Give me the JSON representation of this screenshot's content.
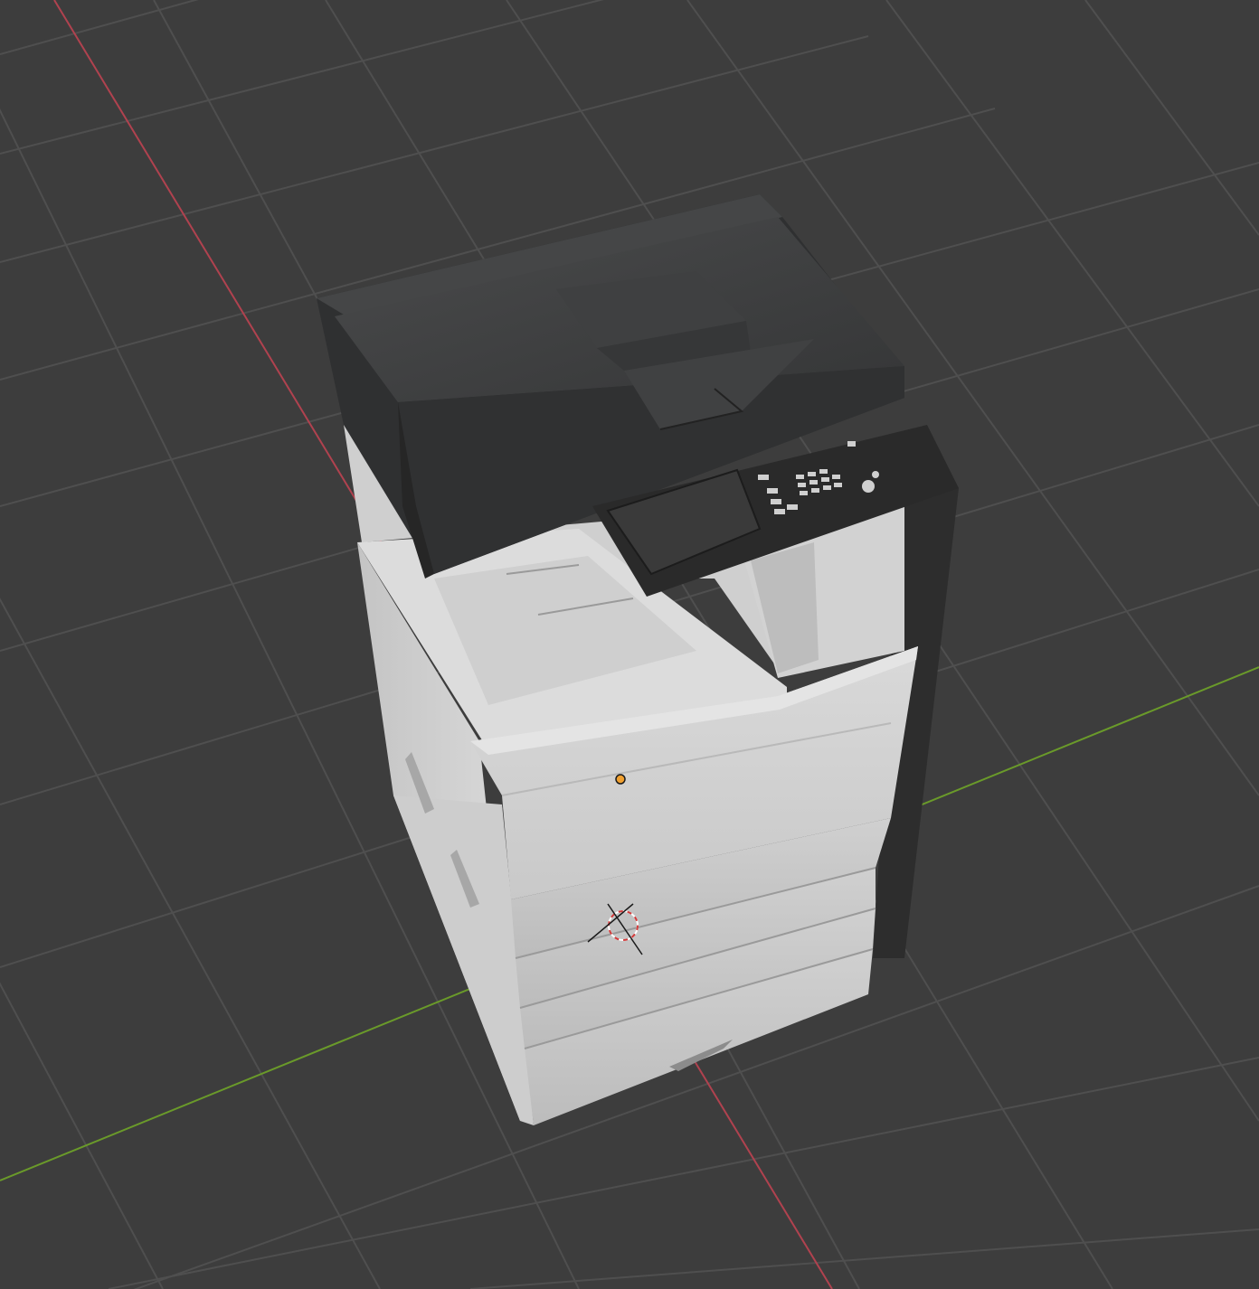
{
  "viewport": {
    "background": "#3d3d3d",
    "grid_color": "#505050",
    "x_axis_color": "#b0424f",
    "y_axis_color": "#6a9a2a",
    "object_origin_color": "#f0a030",
    "cursor_colors": [
      "#d23a3a",
      "#ffffff"
    ]
  },
  "object": {
    "name": "multifunction-printer",
    "body_color": "#d4d4d4",
    "adf_color": "#3b3c3d",
    "panel_color": "#2a2a2a",
    "paper_trays": 4
  }
}
